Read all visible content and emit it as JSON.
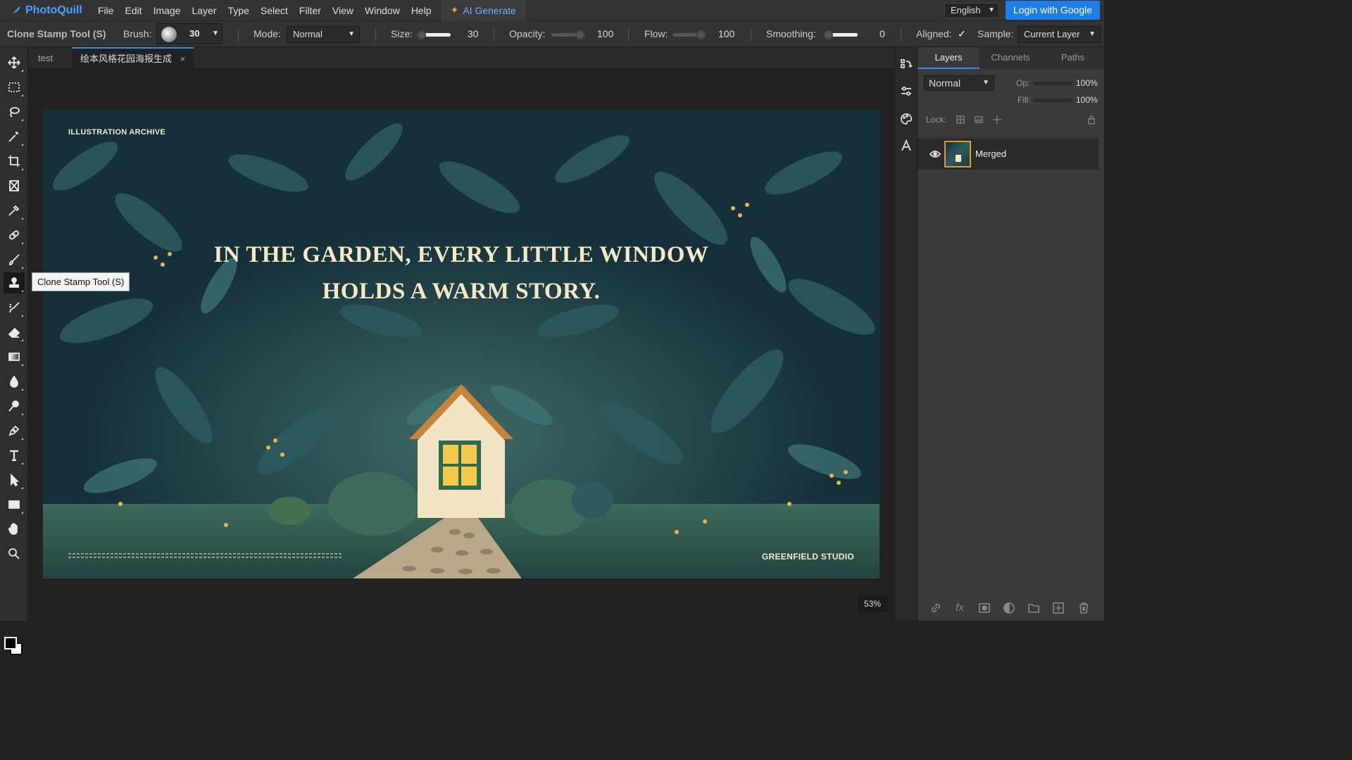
{
  "app": {
    "name": "PhotoQuill",
    "menu": [
      "File",
      "Edit",
      "Image",
      "Layer",
      "Type",
      "Select",
      "Filter",
      "View",
      "Window",
      "Help"
    ],
    "ai_button": "AI Generate",
    "language": "English",
    "login": "Login with Google"
  },
  "options": {
    "tool_name": "Clone Stamp Tool (S)",
    "brush_label": "Brush:",
    "brush_size": "30",
    "mode_label": "Mode:",
    "mode_value": "Normal",
    "size_label": "Size:",
    "size_value": "30",
    "opacity_label": "Opacity:",
    "opacity_value": "100",
    "flow_label": "Flow:",
    "flow_value": "100",
    "smoothing_label": "Smoothing:",
    "smoothing_value": "0",
    "aligned_label": "Aligned:",
    "aligned_check": "✓",
    "sample_label": "Sample:",
    "sample_value": "Current Layer"
  },
  "tooltip": "Clone Stamp Tool (S)",
  "tabs": [
    {
      "label": "test"
    },
    {
      "label": "绘本风格花园海报生成",
      "close": "×"
    }
  ],
  "canvas": {
    "archive_label": "ILLUSTRATION ARCHIVE",
    "headline_line1": "IN THE GARDEN, EVERY LITTLE WINDOW",
    "headline_line2": "HOLDS A WARM STORY.",
    "studio": "GREENFIELD STUDIO"
  },
  "zoom": "53%",
  "panel": {
    "tabs": [
      "Layers",
      "Channels",
      "Paths"
    ],
    "blend_mode": "Normal",
    "opacity_label": "Op:",
    "opacity_value": "100%",
    "fill_label": "Fill:",
    "fill_value": "100%",
    "lock_label": "Lock:",
    "layer_name": "Merged"
  },
  "colors": {
    "accent": "#1e7de6",
    "headline": "#f5e9c4",
    "canvas_bg": "#17303a",
    "layer_selection": "#e19b2a"
  }
}
